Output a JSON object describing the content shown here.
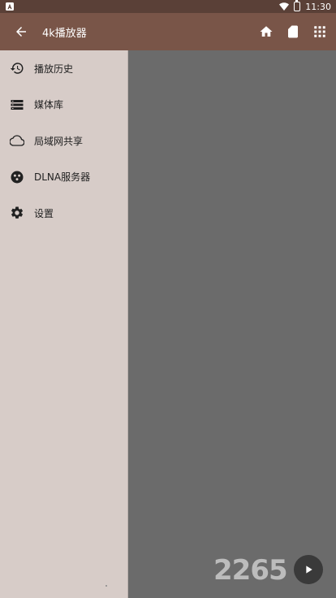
{
  "status_bar": {
    "time": "11:30",
    "icons": [
      "notification-a-icon",
      "wifi-icon",
      "battery-icon"
    ]
  },
  "app_bar": {
    "title": "4k播放器",
    "icons": [
      "back-arrow-icon",
      "home-icon",
      "sd-card-icon",
      "grid-icon"
    ]
  },
  "drawer": {
    "items": [
      {
        "label": "播放历史",
        "icon": "history-icon"
      },
      {
        "label": "媒体库",
        "icon": "list-icon"
      },
      {
        "label": "局域网共享",
        "icon": "cloud-icon"
      },
      {
        "label": "DLNA服务器",
        "icon": "dlna-icon"
      },
      {
        "label": "设置",
        "icon": "gear-icon"
      }
    ]
  },
  "watermark": {
    "text": "2265"
  },
  "colors": {
    "status_bar": "#5a4037",
    "app_bar": "#795548",
    "drawer": "#d7ccc8",
    "content": "#6b6b6b"
  }
}
